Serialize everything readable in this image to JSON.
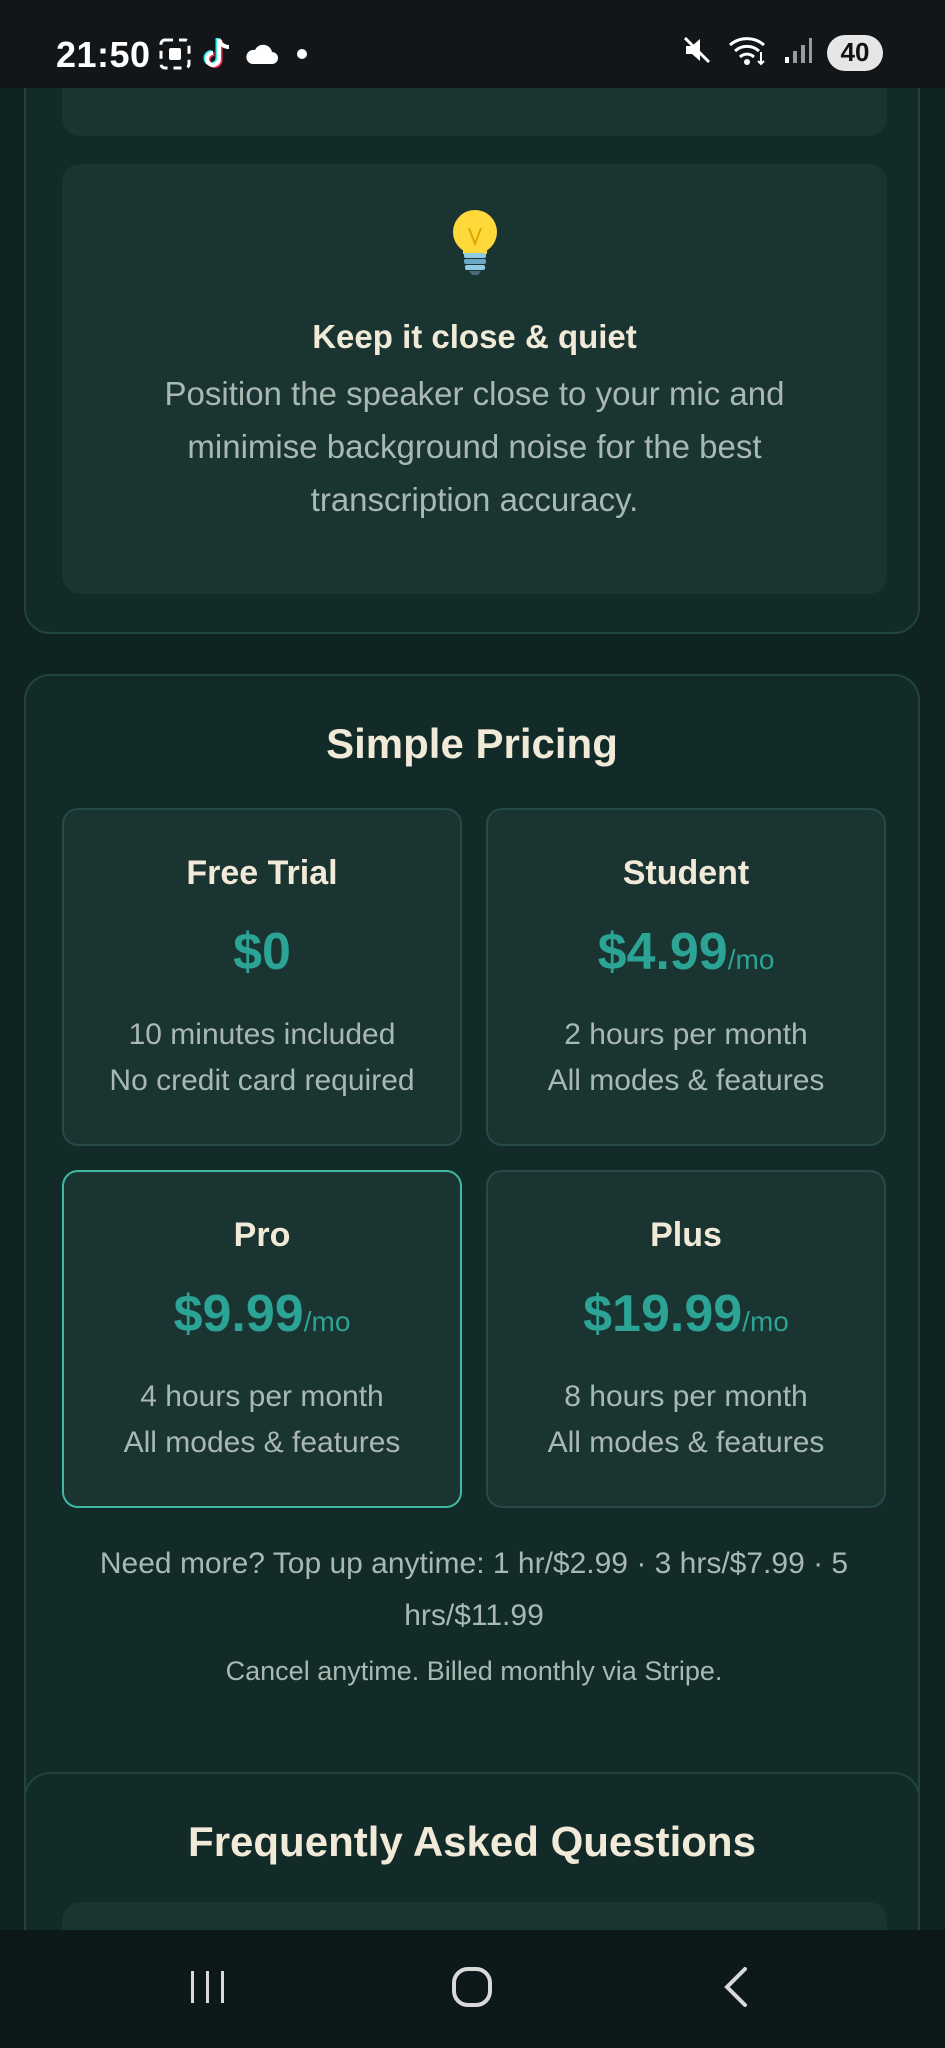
{
  "status_bar": {
    "time": "21:50",
    "left_icons": [
      "screenshot-icon",
      "tiktok-icon",
      "cloud-icon",
      "dot-icon"
    ],
    "right_icons": [
      "mute-icon",
      "wifi-icon",
      "signal-icon"
    ],
    "battery": "40"
  },
  "tip": {
    "icon": "lightbulb-icon",
    "title": "Keep it close & quiet",
    "body": "Position the speaker close to your mic and minimise background noise for the best transcription accuracy."
  },
  "pricing": {
    "title": "Simple Pricing",
    "accent_color": "#2ba395",
    "plans": [
      {
        "name": "Free Trial",
        "price": "$0",
        "period": "",
        "line1": "10 minutes included",
        "line2": "No credit card required",
        "highlighted": false
      },
      {
        "name": "Student",
        "price": "$4.99",
        "period": "/mo",
        "line1": "2 hours per month",
        "line2": "All modes & features",
        "highlighted": false
      },
      {
        "name": "Pro",
        "price": "$9.99",
        "period": "/mo",
        "line1": "4 hours per month",
        "line2": "All modes & features",
        "highlighted": true
      },
      {
        "name": "Plus",
        "price": "$19.99",
        "period": "/mo",
        "line1": "8 hours per month",
        "line2": "All modes & features",
        "highlighted": false
      }
    ],
    "topup_note": "Need more? Top up anytime: 1 hr/$2.99 · 3 hrs/$7.99 · 5 hrs/$11.99",
    "cancel_note": "Cancel anytime. Billed monthly via Stripe."
  },
  "faq": {
    "title": "Frequently Asked Questions"
  },
  "nav": {
    "icons": [
      "recent-apps-icon",
      "home-icon",
      "back-icon"
    ]
  }
}
